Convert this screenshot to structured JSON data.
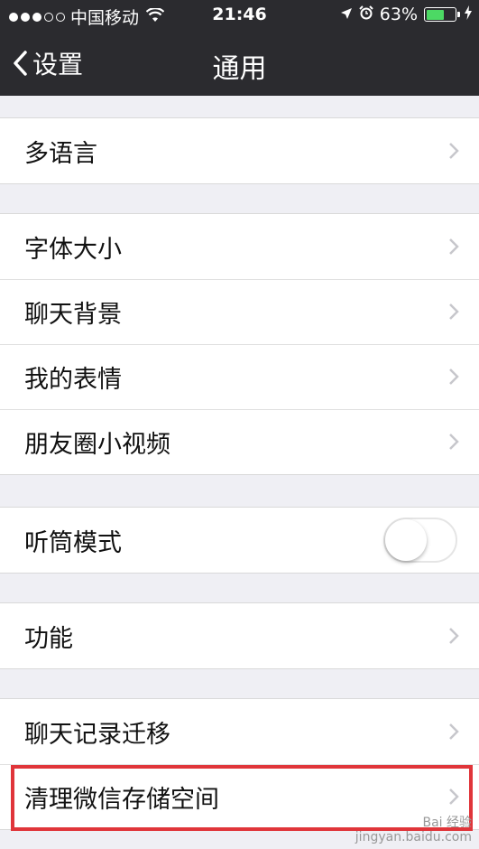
{
  "status_bar": {
    "carrier": "中国移动",
    "time": "21:46",
    "battery_percent": "63%",
    "battery_level": 0.63,
    "signal_dots_filled": 3,
    "signal_dots_total": 5,
    "icons": [
      "wifi-icon",
      "location-arrow-icon",
      "alarm-clock-icon",
      "battery-icon",
      "charging-bolt-icon"
    ]
  },
  "nav": {
    "back_label": "设置",
    "title": "通用"
  },
  "groups": [
    {
      "items": [
        {
          "label": "多语言",
          "type": "chevron"
        }
      ]
    },
    {
      "items": [
        {
          "label": "字体大小",
          "type": "chevron"
        },
        {
          "label": "聊天背景",
          "type": "chevron"
        },
        {
          "label": "我的表情",
          "type": "chevron"
        },
        {
          "label": "朋友圈小视频",
          "type": "chevron"
        }
      ]
    },
    {
      "items": [
        {
          "label": "听筒模式",
          "type": "toggle",
          "on": false
        }
      ]
    },
    {
      "items": [
        {
          "label": "功能",
          "type": "chevron"
        }
      ]
    },
    {
      "items": [
        {
          "label": "聊天记录迁移",
          "type": "chevron"
        },
        {
          "label": "清理微信存储空间",
          "type": "chevron"
        }
      ]
    }
  ],
  "colors": {
    "nav_background": "#2b2b2f",
    "page_background": "#efeff4",
    "highlight_box": "#e0353a",
    "battery_fill": "#4cd964"
  },
  "watermark": {
    "line1": "Bai 经验",
    "line2": "jingyan.baidu.com"
  }
}
